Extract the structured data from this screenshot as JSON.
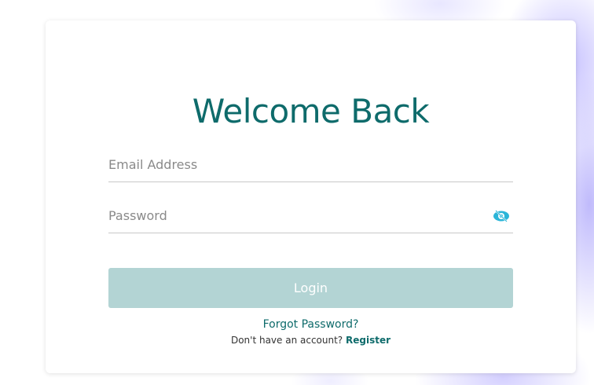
{
  "login": {
    "title": "Welcome Back",
    "email_placeholder": "Email Address",
    "password_placeholder": "Password",
    "login_label": "Login",
    "forgot_label": "Forgot Password?",
    "register_prompt": "Don't have an account?",
    "register_label": "Register",
    "show_password_icon": "eye-slash-icon"
  },
  "colors": {
    "accent": "#0e6b6b",
    "button_disabled": "#b3d4d4",
    "eye_icon": "#2bb5d8",
    "background_art": "#9a90ff"
  }
}
